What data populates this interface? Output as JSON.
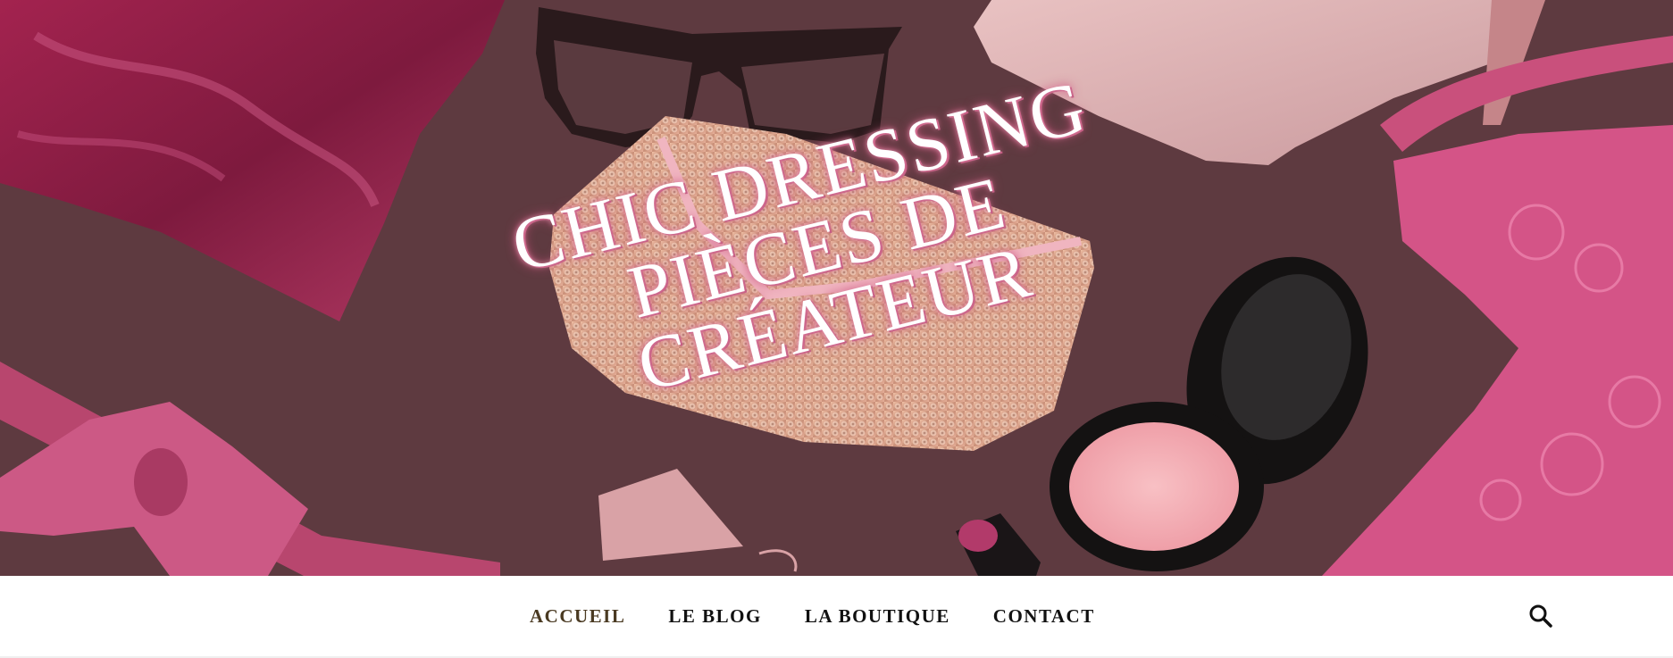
{
  "hero": {
    "title": "CHIC DRESSING PIÈCES DE CRÉATEUR",
    "background_color": "#5e3a40"
  },
  "nav": {
    "items": [
      {
        "label": "ACCUEIL",
        "active": true
      },
      {
        "label": "LE BLOG",
        "active": false
      },
      {
        "label": "LA BOUTIQUE",
        "active": false
      },
      {
        "label": "CONTACT",
        "active": false
      }
    ],
    "active_color": "#4a3a22",
    "search_icon": "search-icon"
  }
}
